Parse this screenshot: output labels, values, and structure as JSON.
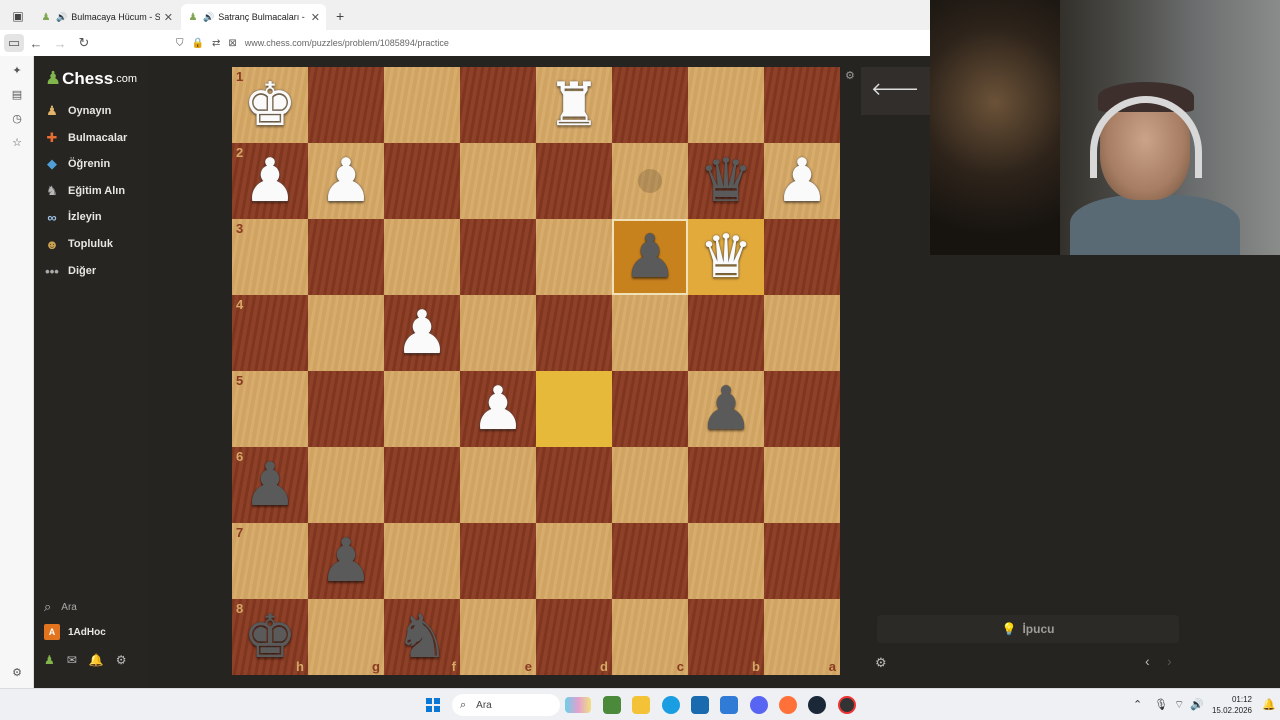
{
  "browser": {
    "tabs": [
      {
        "title": "Bulmacaya Hücum - Satranç",
        "active": false
      },
      {
        "title": "Satranç Bulmacaları - Tema",
        "active": true
      }
    ],
    "new_tab": "+",
    "url": "www.chess.com/puzzles/problem/1085894/practice"
  },
  "sidebar": {
    "logo_main": "Chess",
    "logo_suffix": ".com",
    "items": [
      {
        "label": "Oynayın",
        "icon": "pawn-play-icon"
      },
      {
        "label": "Bulmacalar",
        "icon": "puzzle-icon"
      },
      {
        "label": "Öğrenin",
        "icon": "learn-cap-icon"
      },
      {
        "label": "Eğitim Alın",
        "icon": "coach-icon"
      },
      {
        "label": "İzleyin",
        "icon": "binoculars-icon"
      },
      {
        "label": "Topluluk",
        "icon": "community-icon"
      },
      {
        "label": "Diğer",
        "icon": "more-dots-icon"
      }
    ],
    "search_label": "Ara",
    "user": {
      "initial": "A",
      "name": "1AdHoc"
    }
  },
  "board": {
    "orientation": "black",
    "ranks": [
      "1",
      "2",
      "3",
      "4",
      "5",
      "6",
      "7",
      "8"
    ],
    "files": [
      "h",
      "g",
      "f",
      "e",
      "d",
      "c",
      "b",
      "a"
    ],
    "pieces": {
      "h1": "wK",
      "d1": "wR",
      "h2": "wP",
      "g2": "wP",
      "b2": "bQ",
      "a2": "wP",
      "c3": "bP",
      "b3": "wQ",
      "f4": "wP",
      "e5": "wP",
      "b5": "bP",
      "h6": "bP",
      "g7": "bP",
      "h8": "bK",
      "f8": "bN"
    },
    "highlight_from": "d5",
    "highlight_to": "c3",
    "highlight_to_secondary": "b3",
    "move_dot": "c2"
  },
  "panel": {
    "hint_label": "İpucu"
  },
  "taskbar": {
    "search_label": "Ara",
    "time": "01:12",
    "date": "15.02.2026"
  }
}
